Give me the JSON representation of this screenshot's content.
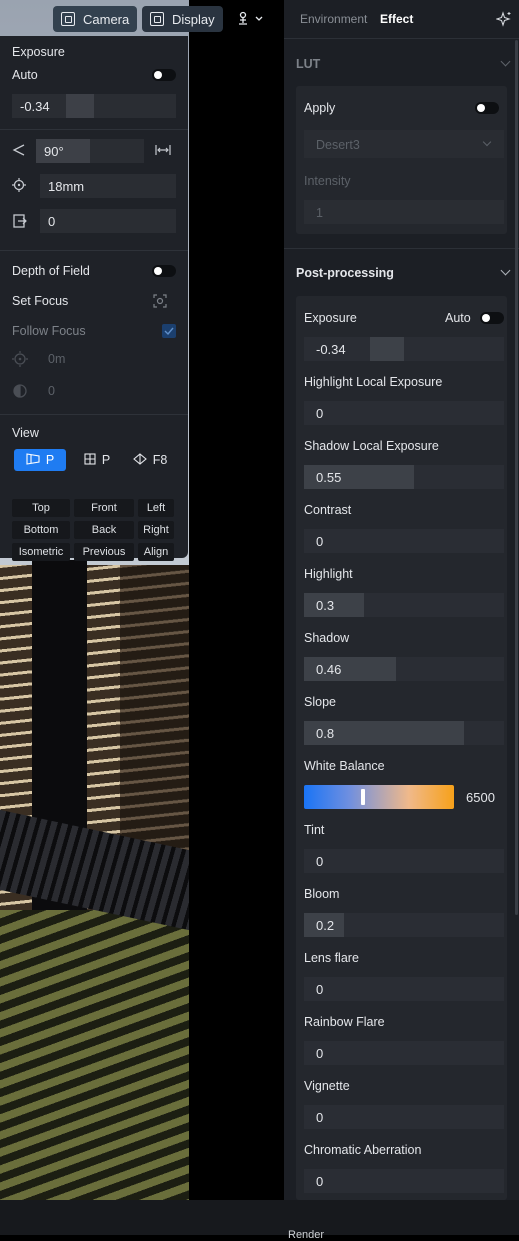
{
  "toolbar": {
    "camera_label": "Camera",
    "display_label": "Display"
  },
  "camera": {
    "exposure_title": "Exposure",
    "auto_label": "Auto",
    "exposure_value": "-0.34",
    "fov_value": "90°",
    "focal_value": "18mm",
    "lens_shift_value": "0",
    "dof_label": "Depth of Field",
    "set_focus_label": "Set Focus",
    "follow_focus_label": "Follow Focus",
    "focus_distance_value": "0m",
    "aperture_value": "0",
    "view_label": "View",
    "view_modes": [
      "P",
      "P",
      "F8"
    ],
    "presets": [
      "Top",
      "Front",
      "Left",
      "Bottom",
      "Back",
      "Right",
      "Isometric",
      "Previous",
      "Align"
    ]
  },
  "panel": {
    "tabs": [
      "Environment",
      "Effect"
    ],
    "lut_title": "LUT",
    "lut_apply_label": "Apply",
    "lut_select_value": "Desert3",
    "intensity_label": "Intensity",
    "intensity_value": "1",
    "post_title": "Post-processing",
    "exposure_label": "Exposure",
    "auto_label": "Auto",
    "exposure_value": "-0.34",
    "white_balance_label": "White Balance",
    "white_balance_value": "6500",
    "white_balance_level": 0.39,
    "params": [
      {
        "label": "Highlight Local Exposure",
        "value": "0",
        "level": 0
      },
      {
        "label": "Shadow Local Exposure",
        "value": "0.55",
        "level": 0.55
      },
      {
        "label": "Contrast",
        "value": "0",
        "level": 0
      },
      {
        "label": "Highlight",
        "value": "0.3",
        "level": 0.3
      },
      {
        "label": "Shadow",
        "value": "0.46",
        "level": 0.46
      },
      {
        "label": "Slope",
        "value": "0.8",
        "level": 0.8
      },
      {
        "label": "Tint",
        "value": "0",
        "level": 0
      },
      {
        "label": "Bloom",
        "value": "0.2",
        "level": 0.2
      },
      {
        "label": "Lens flare",
        "value": "0",
        "level": 0
      },
      {
        "label": "Rainbow Flare",
        "value": "0",
        "level": 0
      },
      {
        "label": "Vignette",
        "value": "0",
        "level": 0
      },
      {
        "label": "Chromatic Aberration",
        "value": "0",
        "level": 0
      }
    ]
  },
  "bottom": {
    "render_label": "Render"
  }
}
